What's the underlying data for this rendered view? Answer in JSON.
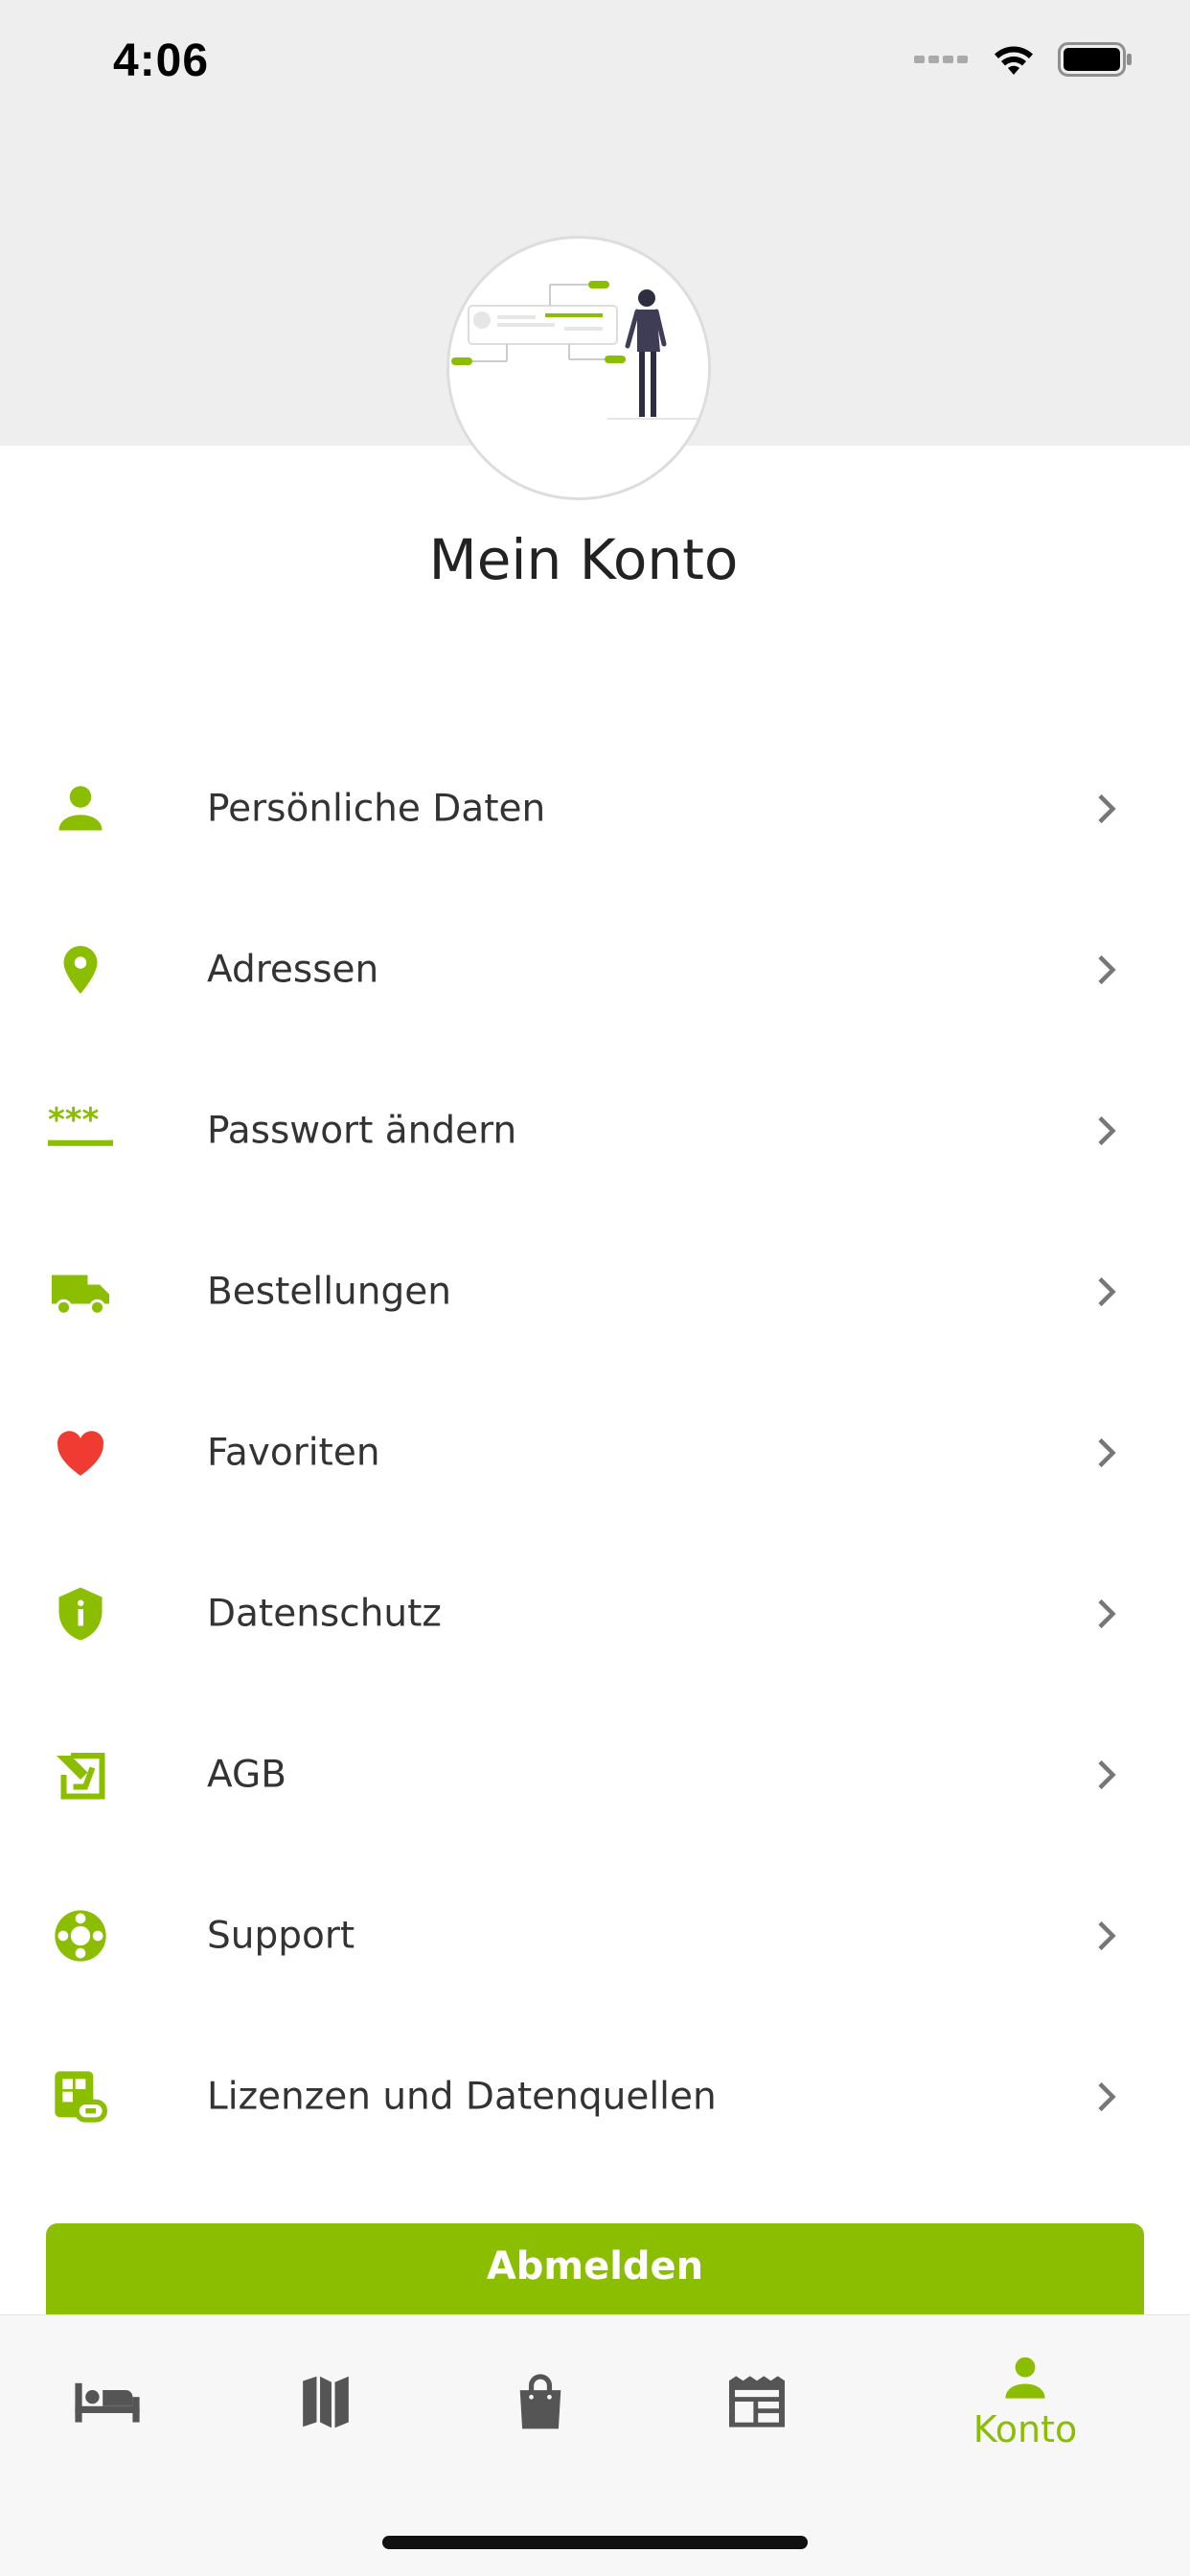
{
  "status_bar": {
    "time": "4:06"
  },
  "header": {
    "title": "Mein Konto"
  },
  "menu": {
    "items": [
      {
        "label": "Persönliche Daten",
        "icon": "person-icon"
      },
      {
        "label": "Adressen",
        "icon": "map-pin-icon"
      },
      {
        "label": "Passwort ändern",
        "icon": "password-icon"
      },
      {
        "label": "Bestellungen",
        "icon": "truck-icon"
      },
      {
        "label": "Favoriten",
        "icon": "heart-icon"
      },
      {
        "label": "Datenschutz",
        "icon": "shield-info-icon"
      },
      {
        "label": "AGB",
        "icon": "document-sign-icon"
      },
      {
        "label": "Support",
        "icon": "lifebuoy-icon"
      },
      {
        "label": "Lizenzen und Datenquellen",
        "icon": "license-link-icon"
      }
    ]
  },
  "logout": {
    "label": "Abmelden"
  },
  "tab_bar": {
    "tabs": [
      {
        "icon": "bed-icon",
        "label": ""
      },
      {
        "icon": "map-icon",
        "label": ""
      },
      {
        "icon": "shopping-bag-icon",
        "label": ""
      },
      {
        "icon": "newspaper-icon",
        "label": ""
      },
      {
        "icon": "person-icon",
        "label": "Konto",
        "active": true
      }
    ]
  },
  "colors": {
    "accent": "#8bbe00",
    "heart": "#ef3b32",
    "header_bg": "#eeeeee",
    "tab_inactive": "#555555"
  }
}
